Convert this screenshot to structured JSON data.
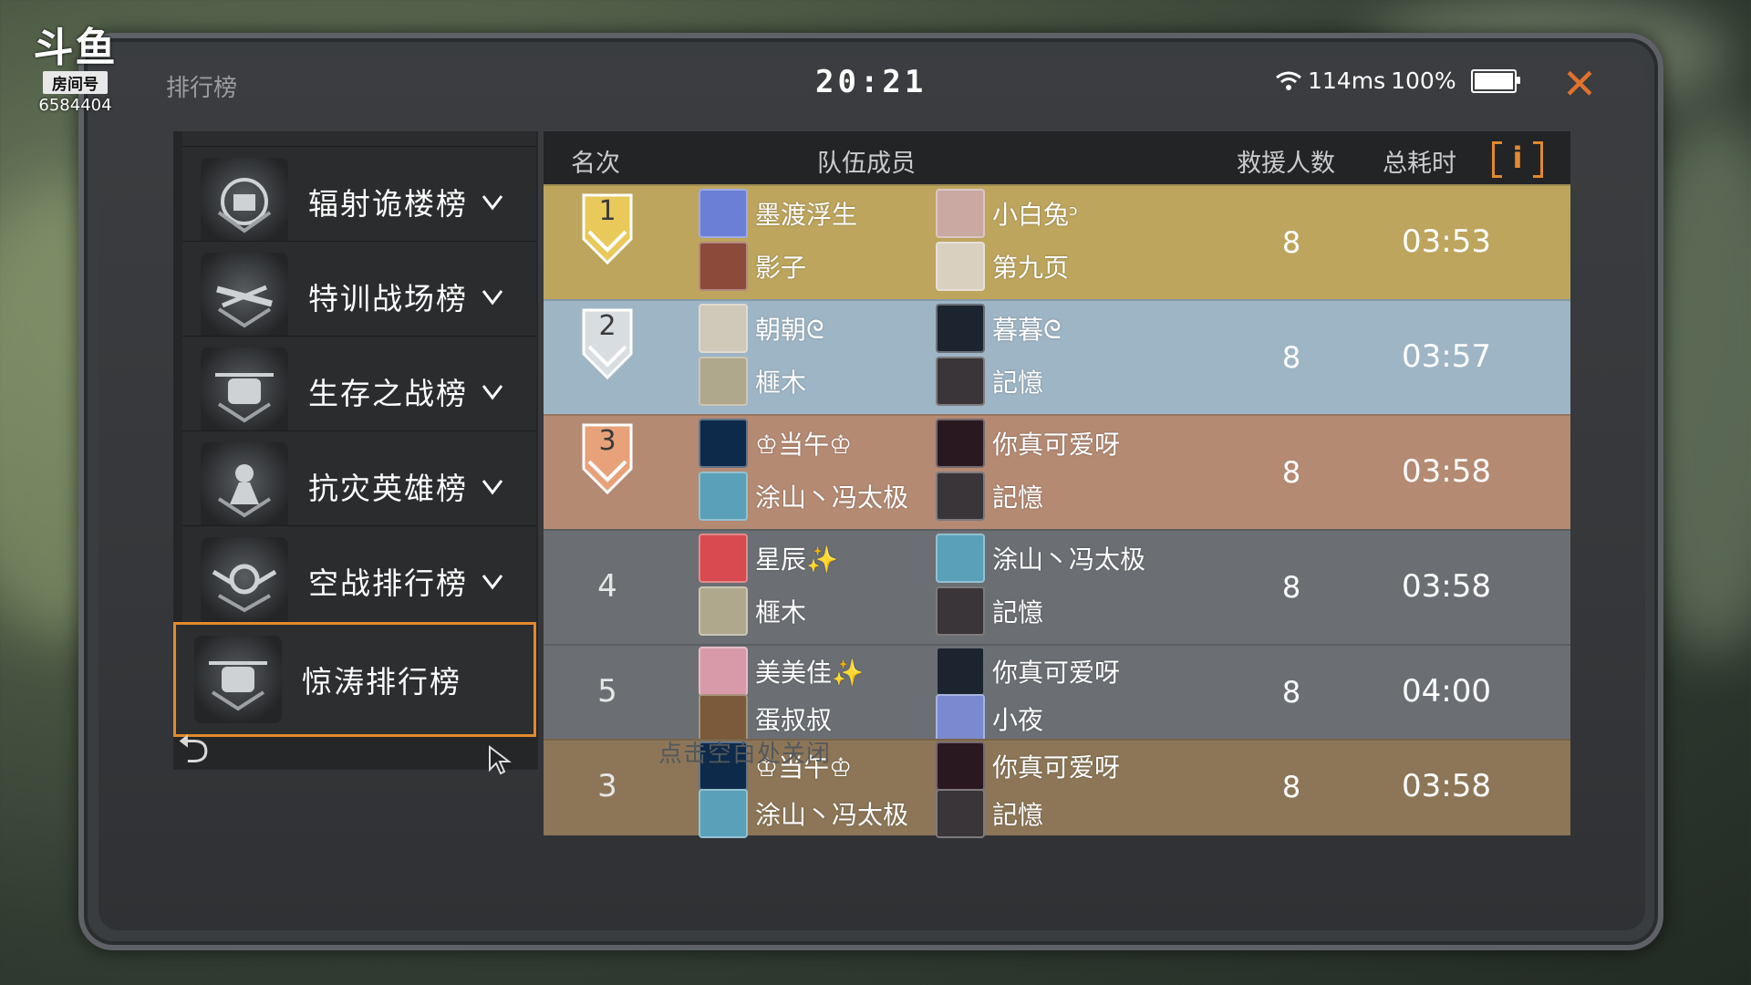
{
  "watermark": {
    "logo": "斗鱼",
    "room_label": "房间号",
    "room_id": "6584404"
  },
  "header": {
    "title": "排行榜",
    "clock": "20:21",
    "ping": "114ms",
    "battery": "100%",
    "battery_level": 1.0
  },
  "sidebar": {
    "items": [
      {
        "label": "辐射诡楼榜",
        "icon": "radiation-emblem-icon"
      },
      {
        "label": "特训战场榜",
        "icon": "sniper-emblem-icon"
      },
      {
        "label": "生存之战榜",
        "icon": "helicopter-emblem-icon"
      },
      {
        "label": "抗灾英雄榜",
        "icon": "hero-emblem-icon"
      },
      {
        "label": "空战排行榜",
        "icon": "wings-emblem-icon"
      },
      {
        "label": "惊涛排行榜",
        "icon": "helicopter-emblem-icon"
      }
    ]
  },
  "table": {
    "headers": {
      "rank": "名次",
      "members": "队伍成员",
      "rescues": "救援人数",
      "time": "总耗时"
    },
    "rows": [
      {
        "rank": "1",
        "members": [
          "墨渡浮生",
          "小白兔ᵓ",
          "影子",
          "第九页"
        ],
        "rescues": "8",
        "time": "03:53"
      },
      {
        "rank": "2",
        "members": [
          "朝朝ᘓ",
          "暮暮ᘓ",
          "榧木",
          "記憶"
        ],
        "rescues": "8",
        "time": "03:57"
      },
      {
        "rank": "3",
        "members": [
          "♔当午♔",
          "你真可爱呀",
          "涂山丶冯太极",
          "記憶"
        ],
        "rescues": "8",
        "time": "03:58"
      },
      {
        "rank": "4",
        "members": [
          "星辰✨",
          "涂山丶冯太极",
          "榧木",
          "記憶"
        ],
        "rescues": "8",
        "time": "03:58"
      },
      {
        "rank": "5",
        "members": [
          "美美佳✨",
          "你真可爱呀",
          "蛋叔叔",
          "小夜"
        ],
        "rescues": "8",
        "time": "04:00"
      },
      {
        "rank": "3",
        "members": [
          "♔当午♔",
          "你真可爱呀",
          "涂山丶冯太极",
          "記憶"
        ],
        "rescues": "8",
        "time": "03:58"
      }
    ]
  },
  "footer": {
    "hint": "点击空白处关闭",
    "back_icon": "back-arrow-icon"
  },
  "colors": {
    "accent": "#e3892e",
    "gold": "#bda55e",
    "silver": "#9eb5c6",
    "bronze": "#b48a73",
    "grey": "#6b6f73",
    "own": "#8c7657"
  }
}
